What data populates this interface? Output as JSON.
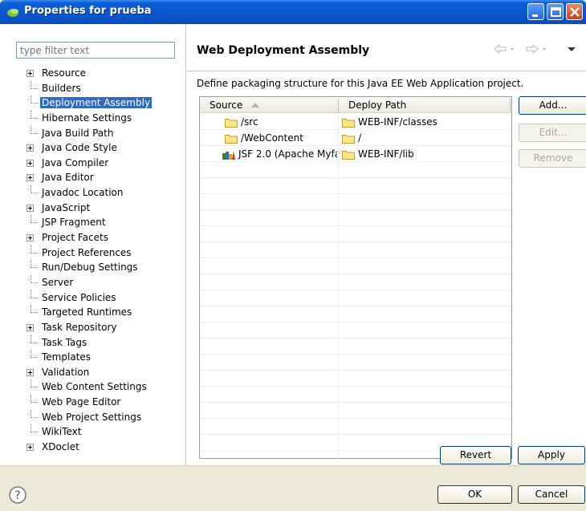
{
  "window": {
    "title": "Properties for prueba",
    "accent": "#0a58d0"
  },
  "filter": {
    "placeholder": "type filter text"
  },
  "tree": {
    "items": [
      {
        "label": "Resource",
        "expandable": true
      },
      {
        "label": "Builders",
        "expandable": false
      },
      {
        "label": "Deployment Assembly",
        "expandable": false,
        "selected": true
      },
      {
        "label": "Hibernate Settings",
        "expandable": false
      },
      {
        "label": "Java Build Path",
        "expandable": false
      },
      {
        "label": "Java Code Style",
        "expandable": true
      },
      {
        "label": "Java Compiler",
        "expandable": true
      },
      {
        "label": "Java Editor",
        "expandable": true
      },
      {
        "label": "Javadoc Location",
        "expandable": false
      },
      {
        "label": "JavaScript",
        "expandable": true
      },
      {
        "label": "JSP Fragment",
        "expandable": false
      },
      {
        "label": "Project Facets",
        "expandable": true
      },
      {
        "label": "Project References",
        "expandable": false
      },
      {
        "label": "Run/Debug Settings",
        "expandable": false
      },
      {
        "label": "Server",
        "expandable": false
      },
      {
        "label": "Service Policies",
        "expandable": false
      },
      {
        "label": "Targeted Runtimes",
        "expandable": false
      },
      {
        "label": "Task Repository",
        "expandable": true
      },
      {
        "label": "Task Tags",
        "expandable": false
      },
      {
        "label": "Templates",
        "expandable": false
      },
      {
        "label": "Validation",
        "expandable": true
      },
      {
        "label": "Web Content Settings",
        "expandable": false
      },
      {
        "label": "Web Page Editor",
        "expandable": false
      },
      {
        "label": "Web Project Settings",
        "expandable": false
      },
      {
        "label": "WikiText",
        "expandable": false
      },
      {
        "label": "XDoclet",
        "expandable": true
      }
    ]
  },
  "page": {
    "title": "Web Deployment Assembly",
    "description": "Define packaging structure for this Java EE Web Application project."
  },
  "table": {
    "columns": [
      "Source",
      "Deploy Path"
    ],
    "rows": [
      {
        "source": "/src",
        "source_icon": "folder-icon",
        "deploy": "WEB-INF/classes",
        "deploy_icon": "folder-icon"
      },
      {
        "source": "/WebContent",
        "source_icon": "folder-icon",
        "deploy": "/",
        "deploy_icon": "folder-icon"
      },
      {
        "source": "JSF 2.0 (Apache Myfa",
        "source_icon": "library-icon",
        "deploy": "WEB-INF/lib",
        "deploy_icon": "folder-icon"
      }
    ]
  },
  "buttons": {
    "add": "Add...",
    "edit": "Edit...",
    "remove": "Remove",
    "revert": "Revert",
    "apply": "Apply",
    "ok": "OK",
    "cancel": "Cancel"
  }
}
